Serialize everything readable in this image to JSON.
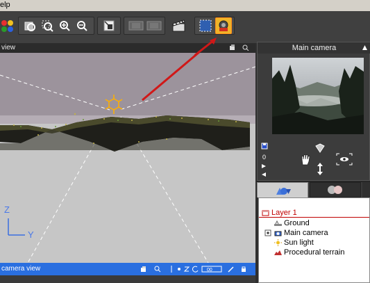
{
  "menu": {
    "partial_label": "elp"
  },
  "viewport": {
    "header_title": "view",
    "footer_title": "camera view",
    "axis": {
      "z": "Z",
      "y": "Y"
    }
  },
  "camera_panel": {
    "title": "Main camera",
    "counter": "0"
  },
  "layers": {
    "root": "Layer 1",
    "items": [
      {
        "label": "Ground",
        "icon": "ground-icon"
      },
      {
        "label": "Main camera",
        "icon": "camera-icon"
      },
      {
        "label": "Sun light",
        "icon": "sun-icon"
      },
      {
        "label": "Procedural terrain",
        "icon": "terrain-icon"
      }
    ]
  },
  "colors": {
    "accent": "#f0b429",
    "footer_blue": "#2a6fe0",
    "layer_red": "#c00000",
    "arrow_red": "#d01818"
  }
}
